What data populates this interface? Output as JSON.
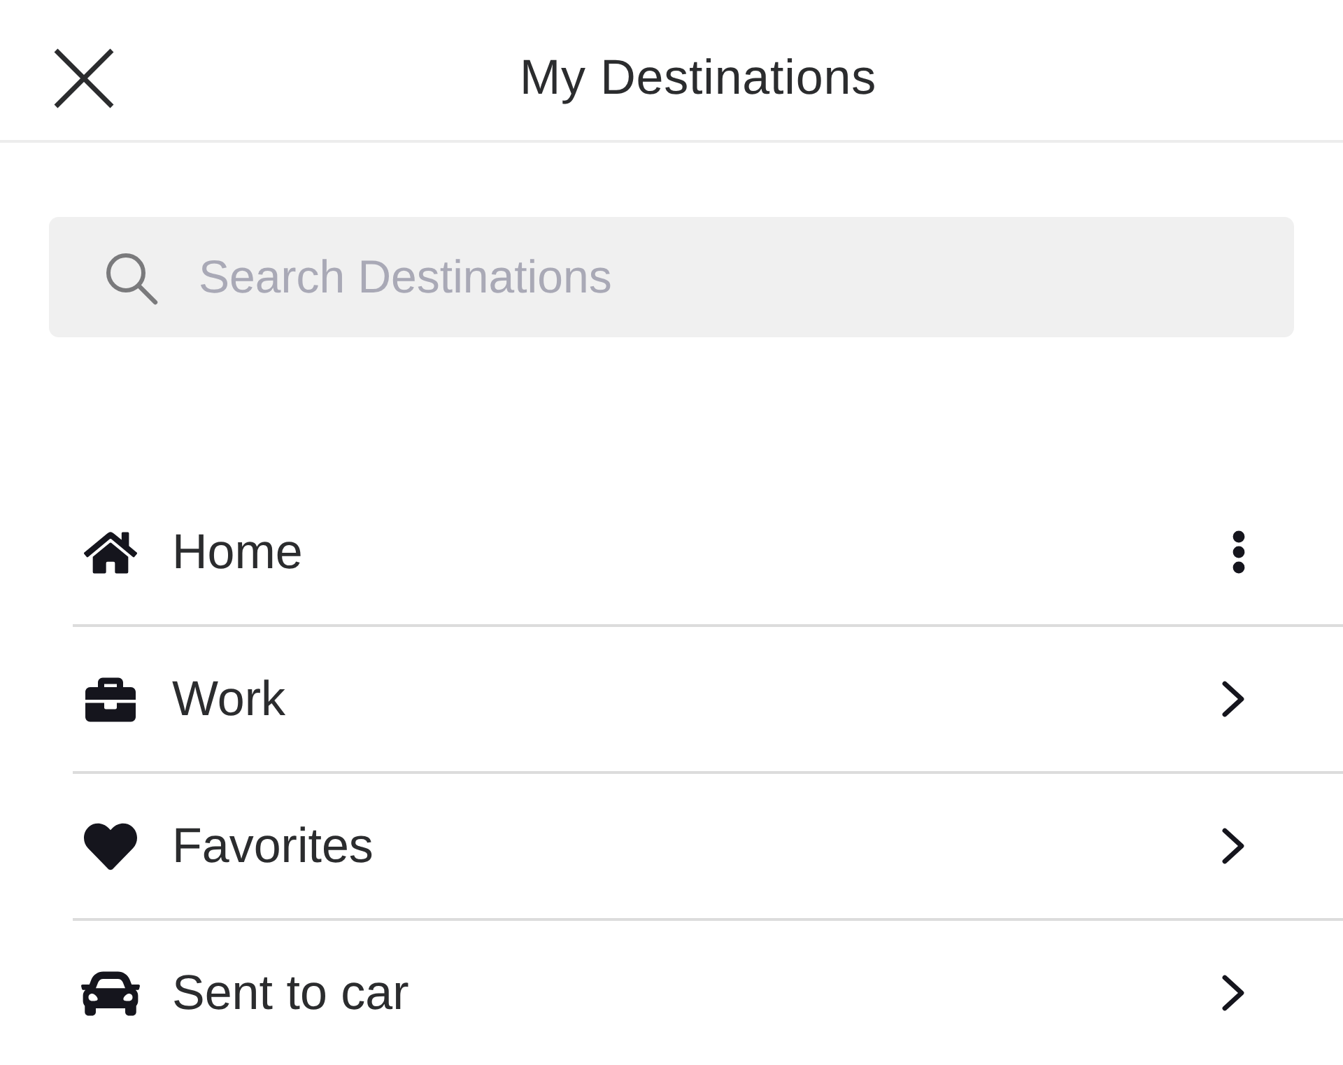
{
  "header": {
    "title": "My Destinations"
  },
  "search": {
    "placeholder": "Search Destinations"
  },
  "destinations": [
    {
      "label": "Home",
      "kind": "options"
    },
    {
      "label": "Work",
      "kind": "link"
    },
    {
      "label": "Favorites",
      "kind": "link"
    },
    {
      "label": "Sent to car",
      "kind": "link"
    }
  ]
}
